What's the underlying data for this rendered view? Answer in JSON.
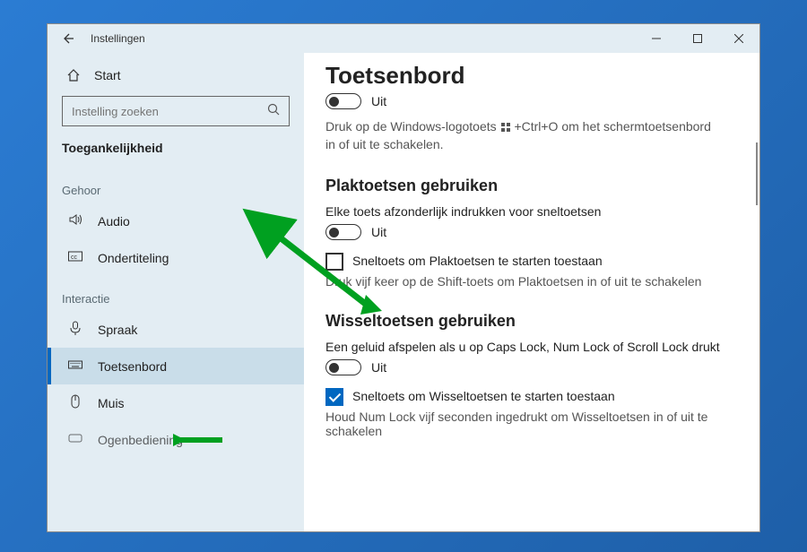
{
  "titlebar": {
    "title": "Instellingen"
  },
  "sidebar": {
    "home_label": "Start",
    "search_placeholder": "Instelling zoeken",
    "section": "Toegankelijkheid",
    "group_gehoor": "Gehoor",
    "audio": "Audio",
    "ondertiteling": "Ondertiteling",
    "group_interactie": "Interactie",
    "spraak": "Spraak",
    "toetsenbord": "Toetsenbord",
    "muis": "Muis",
    "ogenbediening": "Ogenbediening"
  },
  "content": {
    "title": "Toetsenbord",
    "onscreen_toggle_state": "Uit",
    "onscreen_hint_pre": "Druk op de Windows-logotoets",
    "onscreen_hint_post": "+Ctrl+O om het schermtoetsenbord in of uit te schakelen.",
    "sticky_heading": "Plaktoetsen gebruiken",
    "sticky_field": "Elke toets afzonderlijk indrukken voor sneltoetsen",
    "sticky_toggle_state": "Uit",
    "sticky_check_label": "Sneltoets om Plaktoetsen te starten toestaan",
    "sticky_hint": "Druk vijf keer op de Shift-toets om Plaktoetsen in of uit te schakelen",
    "togglekeys_heading": "Wisseltoetsen gebruiken",
    "togglekeys_field": "Een geluid afspelen als u op Caps Lock, Num Lock of Scroll Lock drukt",
    "togglekeys_toggle_state": "Uit",
    "togglekeys_check_label": "Sneltoets om Wisseltoetsen te starten toestaan",
    "togglekeys_hint": "Houd Num Lock vijf seconden ingedrukt om Wisseltoetsen in of uit te schakelen"
  },
  "colors": {
    "accent": "#0067c0",
    "arrow": "#00a020"
  }
}
